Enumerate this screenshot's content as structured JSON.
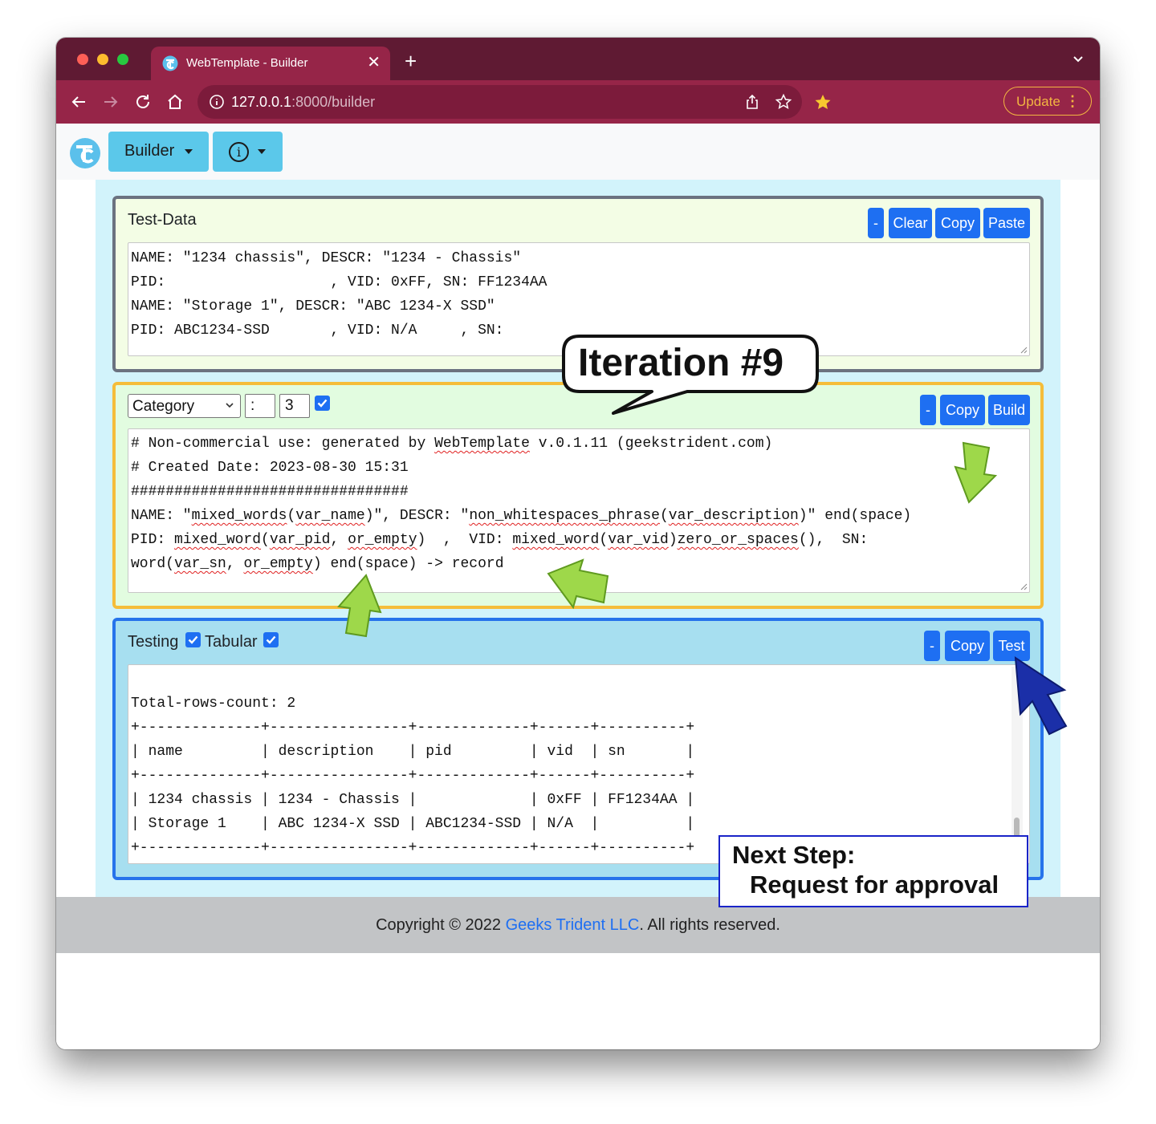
{
  "browser": {
    "tab_title": "WebTemplate - Builder",
    "url_host": "127.0.0.1",
    "url_path": ":8000/builder",
    "update_label": "Update"
  },
  "navbar": {
    "builder_label": "Builder"
  },
  "test_data": {
    "title": "Test-Data",
    "buttons": {
      "collapse": "-",
      "clear": "Clear",
      "copy": "Copy",
      "paste": "Paste"
    },
    "lines": [
      "NAME: \"1234 chassis\", DESCR: \"1234 - Chassis\"",
      "PID:                   , VID: 0xFF, SN: FF1234AA",
      "NAME: \"Storage 1\", DESCR: \"ABC 1234-X SSD\"",
      "PID: ABC1234-SSD       , VID: N/A     , SN:"
    ]
  },
  "template": {
    "select_value": "Category",
    "separator_value": ":",
    "count_value": "3",
    "enabled": true,
    "buttons": {
      "collapse": "-",
      "copy": "Copy",
      "build": "Build"
    },
    "lines": [
      "# Non-commercial use: generated by WebTemplate v.0.1.11 (geekstrident.com)",
      "# Created Date: 2023-08-30 15:31",
      "################################",
      "NAME: \"mixed_words(var_name)\", DESCR: \"non_whitespaces_phrase(var_description)\" end(space)",
      "PID: mixed_word(var_pid, or_empty)  ,  VID: mixed_word(var_vid)zero_or_spaces(),  SN:",
      "word(var_sn, or_empty) end(space) -> record"
    ]
  },
  "testing": {
    "title": "Testing",
    "tabular_label": "Tabular",
    "testing_checked": true,
    "tabular_checked": true,
    "buttons": {
      "collapse": "-",
      "copy": "Copy",
      "test": "Test"
    },
    "lines": [
      "",
      "Total-rows-count: 2",
      "+--------------+----------------+-------------+------+----------+",
      "| name         | description    | pid         | vid  | sn       |",
      "+--------------+----------------+-------------+------+----------+",
      "| 1234 chassis | 1234 - Chassis |             | 0xFF | FF1234AA |",
      "| Storage 1    | ABC 1234-X SSD | ABC1234-SSD | N/A  |          |",
      "+--------------+----------------+-------------+------+----------+"
    ]
  },
  "footer": {
    "prefix": "Copyright © 2022 ",
    "link": "Geeks Trident LLC",
    "suffix": ". All rights reserved."
  },
  "annotations": {
    "bubble": "Iteration #9",
    "next_step_line1": "Next Step:",
    "next_step_line2": "Request for approval"
  },
  "colors": {
    "tabstrip": "#5f1a33",
    "toolbar": "#962548",
    "nav_button": "#5bc8ea",
    "primary_button": "#1e6ff2",
    "test_data_border": "#6b7280",
    "template_border": "#f5bd3a",
    "testing_border": "#2673eb"
  },
  "icons": {
    "tab": [
      "webtemplate-favicon-icon",
      "close-icon",
      "plus-icon",
      "chevron-down-icon"
    ],
    "toolbar": [
      "back-arrow-icon",
      "forward-arrow-icon",
      "reload-icon",
      "home-icon",
      "info-circle-icon",
      "share-icon",
      "star-outline-icon",
      "extension-star-icon",
      "kebab-menu-icon"
    ],
    "annotations": [
      "green-arrow-icon",
      "blue-cursor-arrow-icon"
    ]
  }
}
